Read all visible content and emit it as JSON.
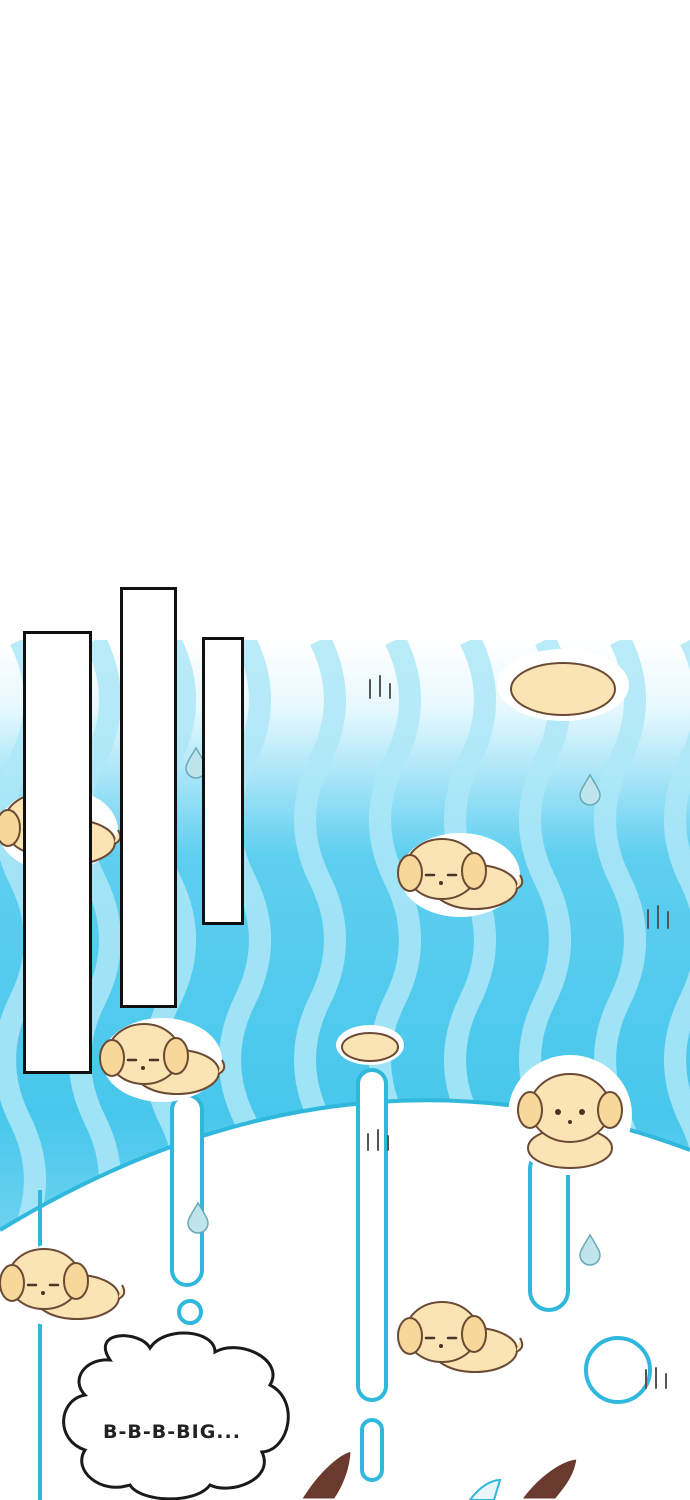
{
  "comic": {
    "speech_bubble": {
      "text": "B-B-B-BIG..."
    },
    "panels": [
      "blank-caption-box",
      "blank-caption-box",
      "blank-caption-box"
    ],
    "colors": {
      "sky_light": "#dff6fd",
      "sky_blue": "#38c3ea",
      "wave_light": "#9fe3f6",
      "outline_cyan": "#2fb8dc",
      "puppy_fur": "#fbe4b3",
      "puppy_outline": "#6b4a35",
      "bubble_fill": "#ffffff",
      "bubble_outline": "#1a1a1a"
    },
    "icons": [
      "puppy-icon",
      "water-drop-icon",
      "sweat-marks-icon",
      "bubble-ring-icon",
      "speech-bubble-icon"
    ]
  }
}
